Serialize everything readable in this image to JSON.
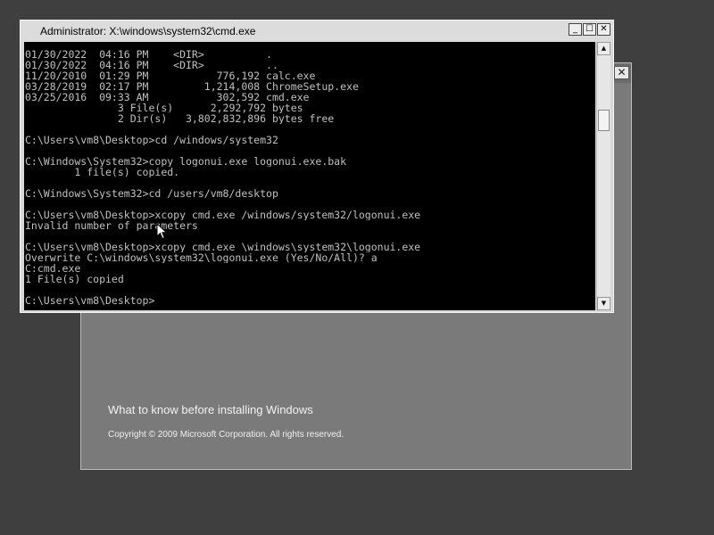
{
  "setup_window": {
    "close_label": "✕",
    "link_label": "What to know before installing Windows",
    "copyright": "Copyright © 2009 Microsoft Corporation. All rights reserved."
  },
  "cmd_window": {
    "title": "Administrator: X:\\windows\\system32\\cmd.exe",
    "minimize_label": "_",
    "maximize_label": "☐",
    "close_label": "✕",
    "lines": [
      "01/30/2022  04:16 PM    <DIR>          .",
      "01/30/2022  04:16 PM    <DIR>          ..",
      "11/20/2010  01:29 PM           776,192 calc.exe",
      "03/28/2019  02:17 PM         1,214,008 ChromeSetup.exe",
      "03/25/2016  09:33 AM           302,592 cmd.exe",
      "               3 File(s)      2,292,792 bytes",
      "               2 Dir(s)   3,802,832,896 bytes free",
      "",
      "C:\\Users\\vm8\\Desktop>cd /windows/system32",
      "",
      "C:\\Windows\\System32>copy logonui.exe logonui.exe.bak",
      "        1 file(s) copied.",
      "",
      "C:\\Windows\\System32>cd /users/vm8/desktop",
      "",
      "C:\\Users\\vm8\\Desktop>xcopy cmd.exe /windows/system32/logonui.exe",
      "Invalid number of parameters",
      "",
      "C:\\Users\\vm8\\Desktop>xcopy cmd.exe \\windows\\system32\\logonui.exe",
      "Overwrite C:\\windows\\system32\\logonui.exe (Yes/No/All)? a",
      "C:cmd.exe",
      "1 File(s) copied",
      "",
      "C:\\Users\\vm8\\Desktop>"
    ]
  },
  "icons": {
    "scroll_up": "scroll-up-arrow-icon",
    "scroll_down": "scroll-down-arrow-icon",
    "cursor": "mouse-pointer-icon"
  }
}
